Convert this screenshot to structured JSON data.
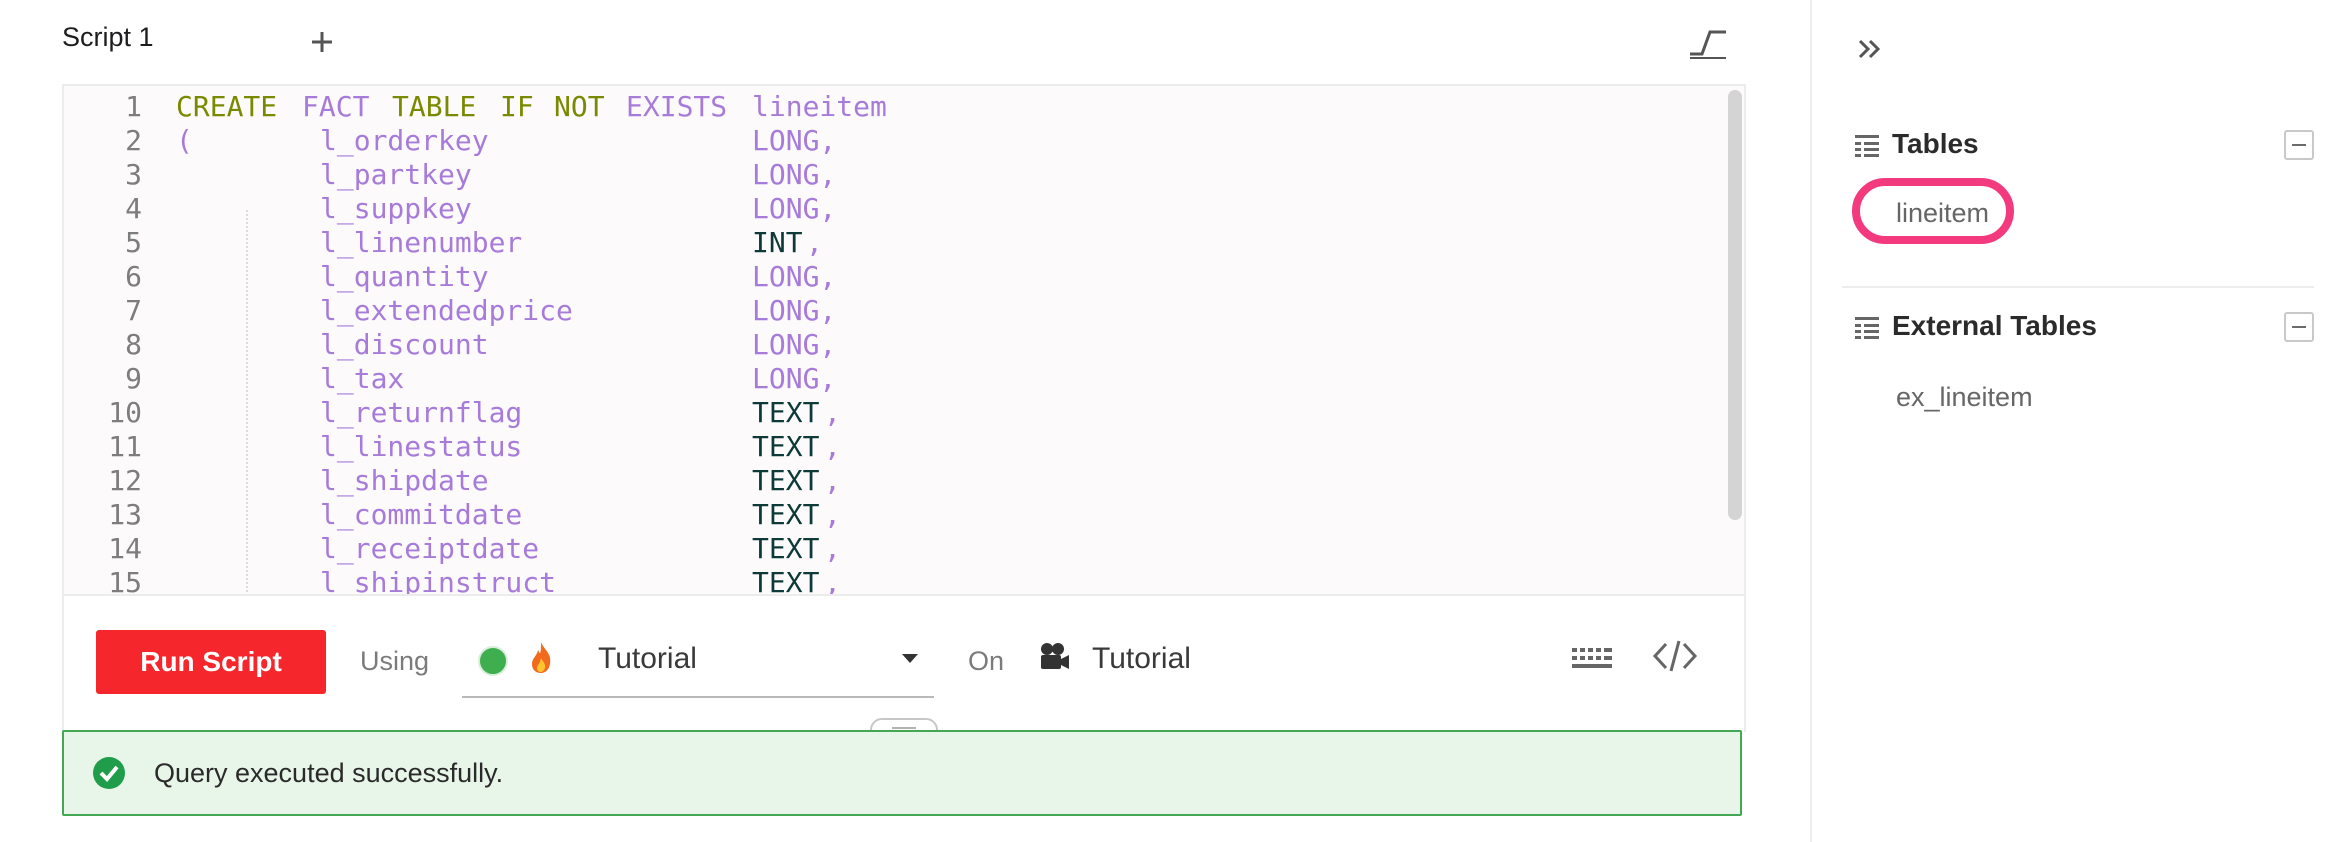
{
  "tab": {
    "title": "Script 1"
  },
  "editor": {
    "lines": [
      {
        "n": "1",
        "tokens": [
          {
            "t": "CREATE",
            "c": "kw-olive",
            "col": 0
          },
          {
            "t": "FACT",
            "c": "kw-purple",
            "col": 7
          },
          {
            "t": "TABLE",
            "c": "kw-olive",
            "col": 12
          },
          {
            "t": "IF",
            "c": "kw-olive",
            "col": 18
          },
          {
            "t": "NOT",
            "c": "kw-olive",
            "col": 21
          },
          {
            "t": "EXISTS",
            "c": "kw-purple",
            "col": 25
          },
          {
            "t": "lineitem",
            "c": "id-purple",
            "col": 32
          }
        ]
      },
      {
        "n": "2",
        "tokens": [
          {
            "t": "(",
            "c": "id-purple",
            "col": 0
          },
          {
            "t": "l_orderkey",
            "c": "id-purple",
            "col": 8
          },
          {
            "t": "LONG,",
            "c": "kw-purple",
            "col": 32
          }
        ]
      },
      {
        "n": "3",
        "tokens": [
          {
            "t": "l_partkey",
            "c": "id-purple",
            "col": 8
          },
          {
            "t": "LONG,",
            "c": "kw-purple",
            "col": 32
          }
        ]
      },
      {
        "n": "4",
        "tokens": [
          {
            "t": "l_suppkey",
            "c": "id-purple",
            "col": 8
          },
          {
            "t": "LONG,",
            "c": "kw-purple",
            "col": 32
          }
        ]
      },
      {
        "n": "5",
        "tokens": [
          {
            "t": "l_linenumber",
            "c": "id-purple",
            "col": 8
          },
          {
            "t": "INT",
            "c": "ty-dark",
            "col": 32
          },
          {
            "t": ",",
            "c": "kw-purple",
            "col": 35
          }
        ]
      },
      {
        "n": "6",
        "tokens": [
          {
            "t": "l_quantity",
            "c": "id-purple",
            "col": 8
          },
          {
            "t": "LONG,",
            "c": "kw-purple",
            "col": 32
          }
        ]
      },
      {
        "n": "7",
        "tokens": [
          {
            "t": "l_extendedprice",
            "c": "id-purple",
            "col": 8
          },
          {
            "t": "LONG,",
            "c": "kw-purple",
            "col": 32
          }
        ]
      },
      {
        "n": "8",
        "tokens": [
          {
            "t": "l_discount",
            "c": "id-purple",
            "col": 8
          },
          {
            "t": "LONG,",
            "c": "kw-purple",
            "col": 32
          }
        ]
      },
      {
        "n": "9",
        "tokens": [
          {
            "t": "l_tax",
            "c": "id-purple",
            "col": 8
          },
          {
            "t": "LONG,",
            "c": "kw-purple",
            "col": 32
          }
        ]
      },
      {
        "n": "10",
        "tokens": [
          {
            "t": "l_returnflag",
            "c": "id-purple",
            "col": 8
          },
          {
            "t": "TEXT",
            "c": "ty-dark",
            "col": 32
          },
          {
            "t": ",",
            "c": "kw-purple",
            "col": 36
          }
        ]
      },
      {
        "n": "11",
        "tokens": [
          {
            "t": "l_linestatus",
            "c": "id-purple",
            "col": 8
          },
          {
            "t": "TEXT",
            "c": "ty-dark",
            "col": 32
          },
          {
            "t": ",",
            "c": "kw-purple",
            "col": 36
          }
        ]
      },
      {
        "n": "12",
        "tokens": [
          {
            "t": "l_shipdate",
            "c": "id-purple",
            "col": 8
          },
          {
            "t": "TEXT",
            "c": "ty-dark",
            "col": 32
          },
          {
            "t": ",",
            "c": "kw-purple",
            "col": 36
          }
        ]
      },
      {
        "n": "13",
        "tokens": [
          {
            "t": "l_commitdate",
            "c": "id-purple",
            "col": 8
          },
          {
            "t": "TEXT",
            "c": "ty-dark",
            "col": 32
          },
          {
            "t": ",",
            "c": "kw-purple",
            "col": 36
          }
        ]
      },
      {
        "n": "14",
        "tokens": [
          {
            "t": "l_receiptdate",
            "c": "id-purple",
            "col": 8
          },
          {
            "t": "TEXT",
            "c": "ty-dark",
            "col": 32
          },
          {
            "t": ",",
            "c": "kw-purple",
            "col": 36
          }
        ]
      },
      {
        "n": "15",
        "tokens": [
          {
            "t": "l_shipinstruct",
            "c": "id-purple",
            "col": 8
          },
          {
            "t": "TEXT",
            "c": "ty-dark",
            "col": 32
          },
          {
            "t": ",",
            "c": "kw-purple",
            "col": 36
          }
        ]
      }
    ]
  },
  "toolbar": {
    "run_label": "Run Script",
    "using_label": "Using",
    "engine_name": "Tutorial",
    "on_label": "On",
    "database_name": "Tutorial"
  },
  "result": {
    "message": "Query executed successfully."
  },
  "sidebar": {
    "tables_title": "Tables",
    "tables": [
      "lineitem"
    ],
    "external_title": "External Tables",
    "external_tables": [
      "ex_lineitem"
    ]
  },
  "colors": {
    "run_button": "#f5272c",
    "status_green": "#3fae4f",
    "success_border": "#44a754",
    "highlight_ring": "#f43a7f"
  },
  "icons": [
    "add-tab-icon",
    "split-view-icon",
    "fire-icon",
    "camera-icon",
    "keyboard-icon",
    "code-icon",
    "check-circle-icon",
    "collapse-panel-icon",
    "table-icon",
    "minus-icon"
  ]
}
